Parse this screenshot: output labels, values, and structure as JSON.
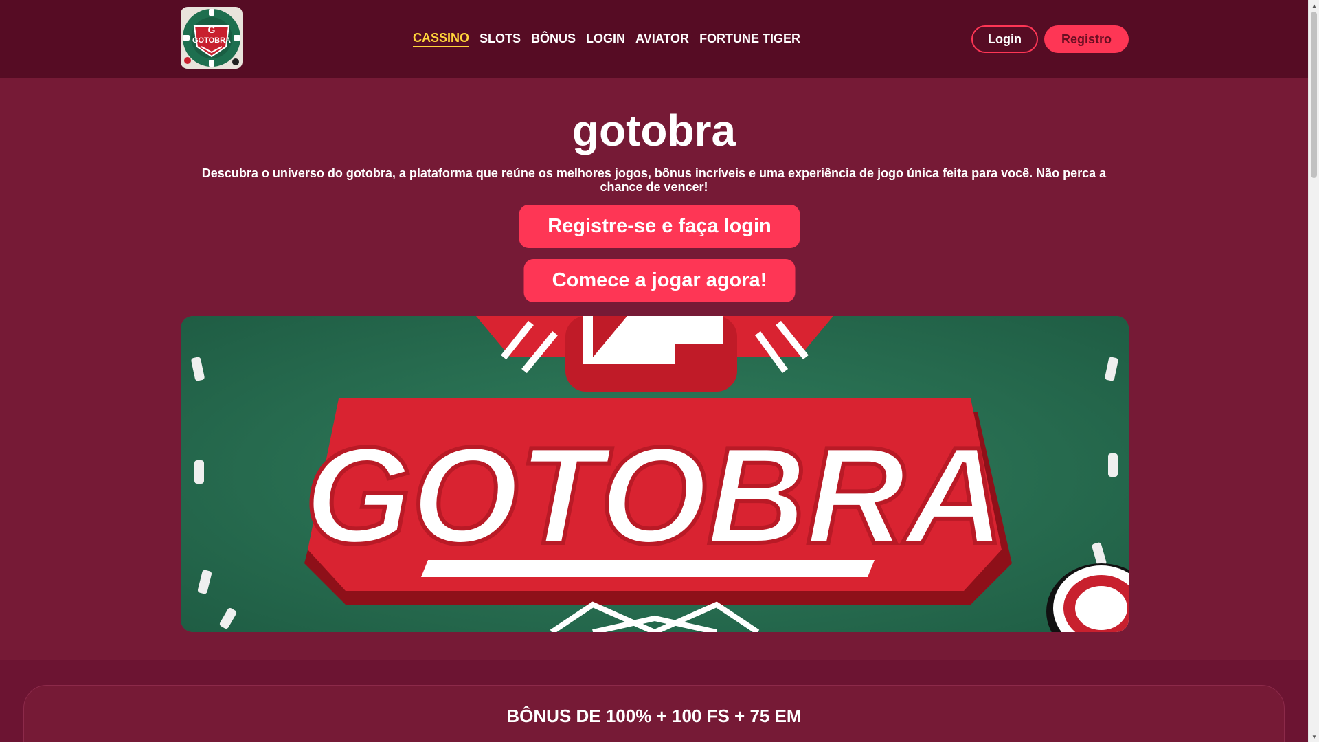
{
  "header": {
    "logo_text": "GOTOBRA",
    "nav": [
      {
        "label": "CASSINO",
        "active": true
      },
      {
        "label": "SLOTS"
      },
      {
        "label": "BÔNUS"
      },
      {
        "label": "LOGIN"
      },
      {
        "label": "AVIATOR"
      },
      {
        "label": "FORTUNE TIGER"
      }
    ],
    "login_label": "Login",
    "register_label": "Registro"
  },
  "hero": {
    "title": "gotobra",
    "description": "Descubra o universo do gotobra, a plataforma que reúne os melhores jogos, bônus incríveis e uma experiência de jogo única feita para você. Não perca a chance de vencer!",
    "cta_primary": "Registre-se e faça login",
    "cta_secondary": "Comece a jogar agora!",
    "banner_text": "GOTOBRA"
  },
  "bonus": {
    "title": "BÔNUS DE 100% + 100 FS + 75 EM"
  },
  "colors": {
    "header_bg": "#560c24",
    "page_bg": "#761a36",
    "accent": "#fe3655",
    "active_nav": "#ffd43b",
    "felt_green": "#2b7355"
  },
  "icons": {
    "logo": "gotobra-chip-logo",
    "scroll_up": "scroll-up-arrow-icon",
    "scroll_down": "scroll-down-arrow-icon"
  }
}
